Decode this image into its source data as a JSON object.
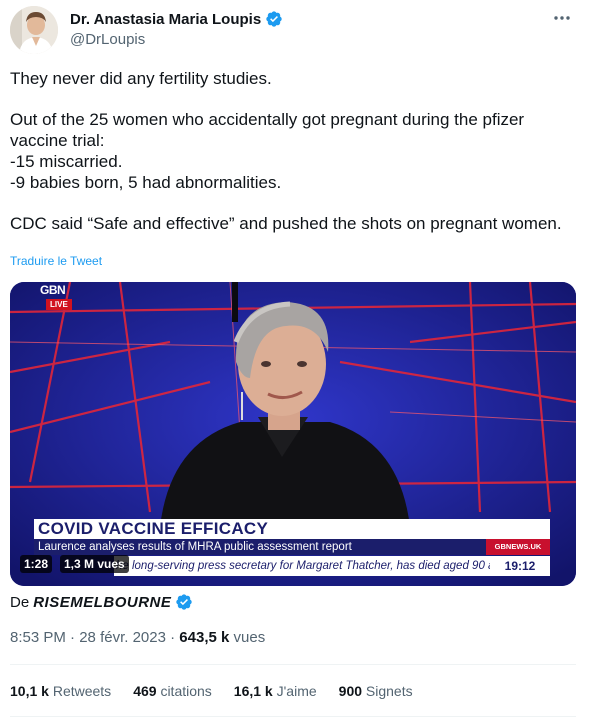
{
  "author": {
    "name": "Dr. Anastasia Maria Loupis",
    "handle": "@DrLoupis"
  },
  "tweet": {
    "paragraphs": [
      "They never did any fertility studies.",
      "Out of the 25 women who accidentally got pregnant during the pfizer vaccine trial:\n-15 miscarried.\n-9 babies born, 5 had abnormalities.",
      "CDC said “Safe and effective” and pushed the shots on pregnant women."
    ],
    "translate_label": "Traduire le Tweet"
  },
  "video": {
    "logo_text": "GBN",
    "live_label": "LIVE",
    "headline": "COVID VACCINE EFFICACY",
    "subheadline": "Laurence analyses results of MHRA public assessment report",
    "channel_tag": "GBNEWS.UK",
    "ticker_text": "he long-serving press secretary for Margaret Thatcher, has died aged 90 a",
    "ticker_clock": "19:12",
    "duration": "1:28",
    "views": "1,3 M vues"
  },
  "attribution": {
    "prefix": "De",
    "source": "RISEMELBOURNE"
  },
  "meta": {
    "time": "8:53 PM",
    "separator": " · ",
    "date": "28 févr. 2023",
    "views_count": "643,5 k",
    "views_label": "vues"
  },
  "stats": [
    {
      "count": "10,1 k",
      "label": "Retweets"
    },
    {
      "count": "469",
      "label": "citations"
    },
    {
      "count": "16,1 k",
      "label": "J'aime"
    },
    {
      "count": "900",
      "label": "Signets"
    }
  ],
  "colors": {
    "accent": "#1d9bf0",
    "verified": "#1d9bf0",
    "secondary_text": "#536471"
  }
}
